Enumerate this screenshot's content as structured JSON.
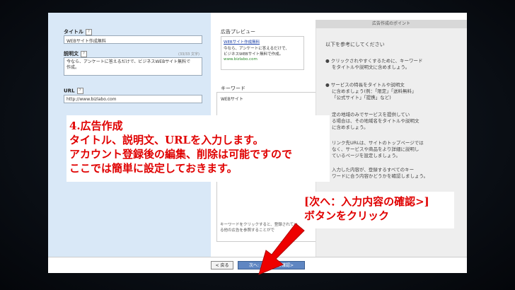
{
  "form": {
    "title_label": "タイトル",
    "title_value": "WEBサイト作成無料",
    "description_label": "説明文",
    "description_counter": "(33/33 文字)",
    "description_value_line1": "今なら、アンケートに答えるだけで、ビジネスWEBサイト無料で",
    "description_value_line2": "作成。",
    "url_label": "URL",
    "url_value": "http://www.bizlabo.com",
    "help_glyph": "?"
  },
  "preview": {
    "title": "広告プレビュー",
    "ad_title": "WEBサイト作成無料",
    "ad_line1": "今なら、アンケートに答えるだけで、",
    "ad_line2": "ビジネスWEBサイト無料で作成。",
    "ad_url": "www.bizlabo.com"
  },
  "keywords": {
    "title": "キーワード",
    "item1": "WEBサイト",
    "note_line1": "キーワードをクリックすると、登録されてい",
    "note_line2": "る他の広告を参照することがで"
  },
  "tips": {
    "header": "広告作成のポイント",
    "intro": "以下を参考にしてください",
    "tip1_line1": "クリックされやすくするために、キーワード",
    "tip1_line2": "をタイトルや説明文に含めましょう。",
    "tip2_line1": "サービスの特長をタイトルや説明文",
    "tip2_line2": "に含めましょう(例：「限定」「送料無料」",
    "tip2_line3": "「公式サイト」「提携」など)",
    "tip3_line1": "定の地域のみでサービスを提供してい",
    "tip3_line2": "る場合は、その地域名をタイトルや説明文",
    "tip3_line3": "に含めましょう。",
    "tip4_line1": "リンク先URLは、サイトのトップページでは",
    "tip4_line2": "なく、サービスや商品をより詳細に説明し",
    "tip4_line3": "ているページを設定しましょう。",
    "tip5_line1": "入力した内容が、登録するすべてのキー",
    "tip5_line2": "ワードに合う内容かどうかを確認しましょう。",
    "bullet": "●"
  },
  "buttons": {
    "back": "< 戻る",
    "next": "次へ: 入力内容の確認>"
  },
  "callout_main": {
    "line1": "4.広告作成",
    "line2": "タイトル、説明文、URLを入力します。",
    "line3": "アカウント登録後の編集、削除は可能ですので",
    "line4": "ここでは簡単に設定しておきます。"
  },
  "callout_button": {
    "line1": "[次へ：入力内容の確認>]",
    "line2": "ボタンをクリック"
  },
  "colors": {
    "annotation_red": "#e00000",
    "form_panel": "#d9e8f7",
    "next_button": "#5f86c2"
  }
}
